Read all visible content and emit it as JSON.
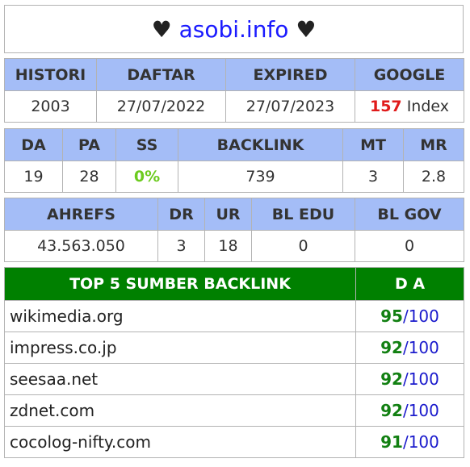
{
  "title": {
    "prefix": "♥",
    "site": "asobi.info",
    "suffix": "♥"
  },
  "history_table": {
    "headers": [
      "HISTORI",
      "DAFTAR",
      "EXPIRED",
      "GOOGLE"
    ],
    "histori": "2003",
    "daftar": "27/07/2022",
    "expired": "27/07/2023",
    "google_count": "157",
    "google_label": "Index"
  },
  "da_table": {
    "headers": [
      "DA",
      "PA",
      "SS",
      "BACKLINK",
      "MT",
      "MR"
    ],
    "da": "19",
    "pa": "28",
    "ss": "0%",
    "backlink": "739",
    "mt": "3",
    "mr": "2.8"
  },
  "ahrefs_table": {
    "headers": [
      "AHREFS",
      "DR",
      "UR",
      "BL EDU",
      "BL GOV"
    ],
    "ahrefs": "43.563.050",
    "dr": "3",
    "ur": "18",
    "bl_edu": "0",
    "bl_gov": "0"
  },
  "top_backlinks": {
    "header": "TOP 5 SUMBER BACKLINK",
    "da_header": "D A",
    "rows": [
      {
        "domain": "wikimedia.org",
        "score": "95",
        "slash": "/",
        "max": "100"
      },
      {
        "domain": "impress.co.jp",
        "score": "92",
        "slash": "/",
        "max": "100"
      },
      {
        "domain": "seesaa.net",
        "score": "92",
        "slash": "/",
        "max": "100"
      },
      {
        "domain": "zdnet.com",
        "score": "92",
        "slash": "/",
        "max": "100"
      },
      {
        "domain": "cocolog-nifty.com",
        "score": "91",
        "slash": "/",
        "max": "100"
      }
    ]
  },
  "colors": {
    "header_bg": "#a4bdf7",
    "top_header_bg": "#008000",
    "site_link": "#1a1aff",
    "google_count": "#e01b1b",
    "ss_value": "#6ccb1f",
    "score": "#128012",
    "score_max": "#1a1acc"
  }
}
